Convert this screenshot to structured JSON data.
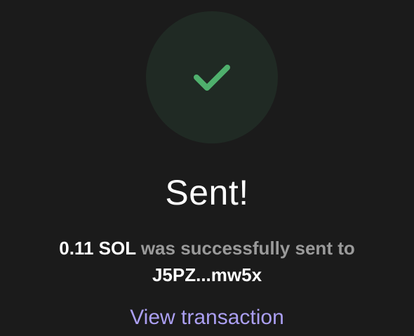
{
  "status": {
    "icon": "checkmark-icon",
    "accent_color": "#4fb06d",
    "badge_color": "#202a24"
  },
  "title": "Sent!",
  "message": {
    "amount": "0.11 SOL",
    "text": " was successfully sent to ",
    "recipient": "J5PZ...mw5x"
  },
  "link": {
    "label": "View transaction",
    "color": "#ab9ff2"
  }
}
